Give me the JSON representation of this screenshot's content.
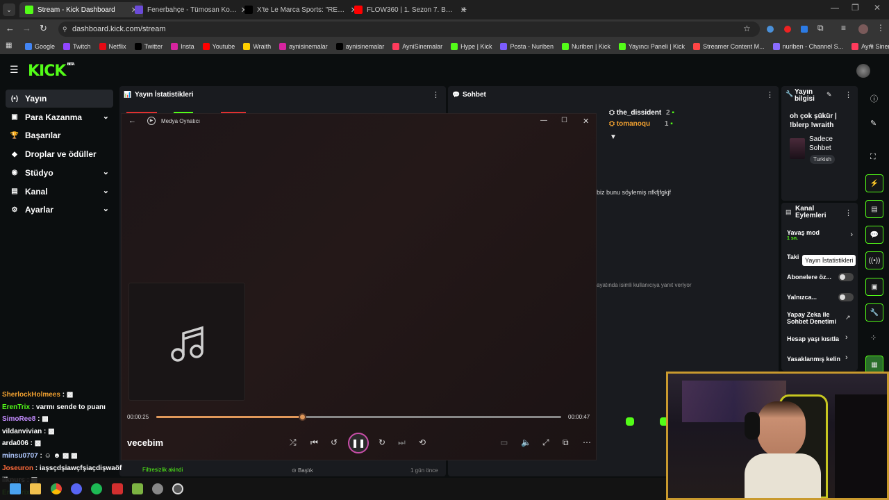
{
  "browser": {
    "tabs": [
      {
        "label": "Stream - Kick Dashboard",
        "active": true,
        "color": "#53fc18"
      },
      {
        "label": "Fenerbahçe - Tümosan Konyaspor",
        "active": false,
        "color": "#6b4bd8"
      },
      {
        "label": "X'te Le Marca Sports: \"RESMİ | ...",
        "active": false,
        "color": "#000000"
      },
      {
        "label": "FLOW360 | 1. Sezon 7. Bölüm | ...",
        "active": false,
        "color": "#ff0000"
      }
    ],
    "url": "dashboard.kick.com/stream",
    "bookmarks": [
      "Google",
      "Twitch",
      "Netflix",
      "Twitter",
      "Insta",
      "Youtube",
      "Wraith",
      "aynisinemalar",
      "aynisinemalar",
      "AyniSinemalar",
      "Hype | Kick",
      "Posta - Nuriben",
      "Nuriben | Kick",
      "Yayıncı Paneli | Kick",
      "Streamer Content M...",
      "nuriben - Channel S...",
      "Aynı Sinemalar - Ça..."
    ]
  },
  "kick": {
    "logo": "KICK",
    "beta": "BETA",
    "nav": [
      {
        "label": "Yayın",
        "icon": "(•)",
        "active": true,
        "chev": false
      },
      {
        "label": "Para Kazanma",
        "icon": "▣",
        "active": false,
        "chev": true
      },
      {
        "label": "Başarılar",
        "icon": "🏆",
        "active": false,
        "chev": false
      },
      {
        "label": "Droplar ve ödüller",
        "icon": "◆",
        "active": false,
        "chev": false
      },
      {
        "label": "Stüdyo",
        "icon": "◉",
        "active": false,
        "chev": true
      },
      {
        "label": "Kanal",
        "icon": "▤",
        "active": false,
        "chev": true
      },
      {
        "label": "Ayarlar",
        "icon": "⚙",
        "active": false,
        "chev": true
      }
    ],
    "stats_title": "Yayın İstatistikleri",
    "chat_title": "Sohbet",
    "chat_users": [
      {
        "name": "the_dissident",
        "count": "2"
      },
      {
        "name": "tomanoqu",
        "count": "1"
      }
    ],
    "chat_snippet1": "biz bunu söylemiş nfkfjfgkjf",
    "chat_snippet2": "ayatında isimli kullanıcıya yanıt veriyor",
    "stream_info_title": "Yayın bilgisi",
    "stream_title_text": "oh çok şükür | !blerp !wraith",
    "category": "Sadece Sohbet",
    "language_tag": "Turkish",
    "channel_actions_title": "Kanal Eylemleri",
    "actions": [
      {
        "label": "Yavaş mod",
        "sub": "1 sn."
      },
      {
        "label": "Taki"
      },
      {
        "label": "Abonelere öz..."
      },
      {
        "label": "Yalnızca..."
      },
      {
        "label": "Yapay Zeka ile Sohbet Denetimi"
      },
      {
        "label": "Hesap yaşı kısıtla"
      },
      {
        "label": "Yasaklanmış kelin"
      }
    ],
    "tooltip": "Yayın İstatistikleri",
    "bottom_left": "Filtresizlik akindi",
    "bottom_mid": "Başlık",
    "bottom_time": "1 gün önce"
  },
  "player": {
    "title": "Medya Oynatıcı",
    "track": "vecebim",
    "elapsed": "00:00:25",
    "total": "00:00:47",
    "progress": 0.36
  },
  "chat_overlay": [
    {
      "user": "SherlockHolmees",
      "text": " : ▩",
      "color": "#f0a030"
    },
    {
      "user": "ErenTrix",
      "text": " : varmı sende to puanı",
      "color": "#53fc18"
    },
    {
      "user": "SimoRee8",
      "text": " : ▩",
      "color": "#c48cff"
    },
    {
      "user": "vildanvivian",
      "text": " : ▩",
      "color": "#ffffff"
    },
    {
      "user": "arda006",
      "text": " : ▩",
      "color": "#ffffff"
    },
    {
      "user": "minsu0707",
      "text": " : ☺ ☻ ▩ ▩",
      "color": "#b0c8ff"
    },
    {
      "user": "Joseuron",
      "text": " : iaşsçdşiawçfşiaçdişwaöf",
      "color": "#ff6a3a"
    },
    {
      "user": "ilknurs",
      "text": " : ▩",
      "color": "#ffffff"
    },
    {
      "user": "ErenTrix",
      "text": " : ",
      "color": "#53fc18"
    }
  ],
  "colors": {
    "kick_green": "#53fc18",
    "cam_border": "#c99a2e",
    "seek": "#e0985a"
  }
}
